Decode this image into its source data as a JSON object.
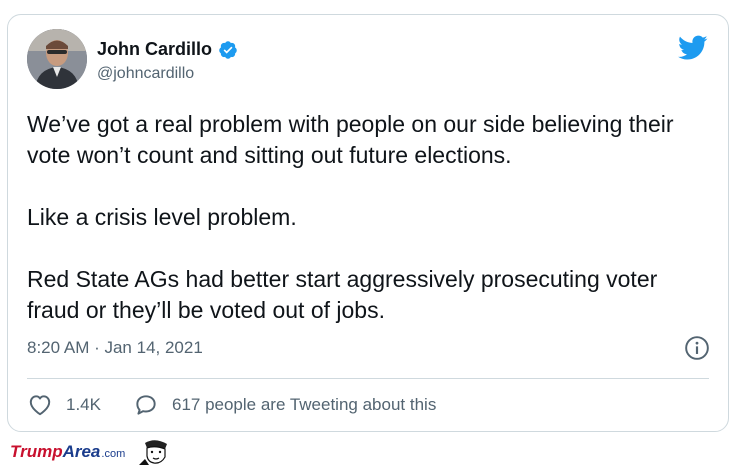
{
  "tweet": {
    "author_name": "John Cardillo",
    "author_handle": "@johncardillo",
    "verified": true,
    "paragraphs": [
      "We’ve got a real problem with people on our side believing their vote won’t count and sitting out future elections.",
      "Like a crisis level problem.",
      "Red State AGs had better start aggressively prosecuting voter fraud or they’ll be voted out of jobs."
    ],
    "timestamp": "8:20 AM · Jan 14, 2021",
    "likes": "1.4K",
    "conversation": "617 people are Tweeting about this"
  },
  "icons": {
    "brand": "twitter-bird-icon",
    "verified": "verified-badge-icon",
    "info": "info-icon",
    "like": "heart-icon",
    "conversation": "speech-bubble-icon"
  },
  "watermark": {
    "part1": "Trump",
    "part2": "Area",
    "part3": ".com"
  },
  "colors": {
    "twitter_blue": "#1d9bf0",
    "text": "#0f1419",
    "secondary": "#536471",
    "border": "#cfd9de",
    "watermark_red": "#c8102e",
    "watermark_blue": "#1a3c8c"
  }
}
